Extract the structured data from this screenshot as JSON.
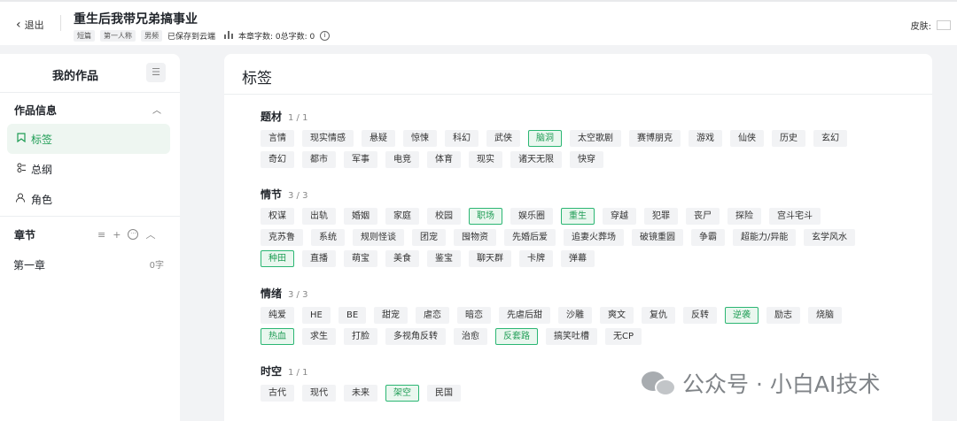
{
  "header": {
    "back_label": "退出",
    "book_title": "重生后我带兄弟搞事业",
    "pills": [
      "短篇",
      "第一人称",
      "男频"
    ],
    "save_status": "已保存到云端",
    "stats": "本章字数: 0总字数: 0",
    "skin_label": "皮肤:"
  },
  "sidebar": {
    "title": "我的作品",
    "section_info": "作品信息",
    "items": [
      {
        "label": "标签",
        "icon": "bookmark-icon",
        "active": true
      },
      {
        "label": "总纲",
        "icon": "outline-icon",
        "active": false
      },
      {
        "label": "角色",
        "icon": "user-icon",
        "active": false
      }
    ],
    "section_chapters": "章节",
    "chapters": [
      {
        "title": "第一章",
        "count": "0字"
      }
    ]
  },
  "main": {
    "title": "标签",
    "groups": [
      {
        "name": "题材",
        "count": "1 / 1",
        "rows": [
          [
            [
              "言情",
              false
            ],
            [
              "现实情感",
              false
            ],
            [
              "悬疑",
              false
            ],
            [
              "惊悚",
              false
            ],
            [
              "科幻",
              false
            ],
            [
              "武侠",
              false
            ],
            [
              "脑洞",
              true
            ],
            [
              "太空歌剧",
              false
            ],
            [
              "赛博朋克",
              false
            ],
            [
              "游戏",
              false
            ],
            [
              "仙侠",
              false
            ],
            [
              "历史",
              false
            ],
            [
              "玄幻",
              false
            ]
          ],
          [
            [
              "奇幻",
              false
            ],
            [
              "都市",
              false
            ],
            [
              "军事",
              false
            ],
            [
              "电竞",
              false
            ],
            [
              "体育",
              false
            ],
            [
              "现实",
              false
            ],
            [
              "诸天无限",
              false
            ],
            [
              "快穿",
              false
            ]
          ]
        ]
      },
      {
        "name": "情节",
        "count": "3 / 3",
        "rows": [
          [
            [
              "权谋",
              false
            ],
            [
              "出轨",
              false
            ],
            [
              "婚姻",
              false
            ],
            [
              "家庭",
              false
            ],
            [
              "校园",
              false
            ],
            [
              "职场",
              true
            ],
            [
              "娱乐圈",
              false
            ],
            [
              "重生",
              true
            ],
            [
              "穿越",
              false
            ],
            [
              "犯罪",
              false
            ],
            [
              "丧尸",
              false
            ],
            [
              "探险",
              false
            ],
            [
              "宫斗宅斗",
              false
            ]
          ],
          [
            [
              "克苏鲁",
              false
            ],
            [
              "系统",
              false
            ],
            [
              "规则怪谈",
              false
            ],
            [
              "团宠",
              false
            ],
            [
              "囤物资",
              false
            ],
            [
              "先婚后爱",
              false
            ],
            [
              "追妻火葬场",
              false
            ],
            [
              "破镜重圆",
              false
            ],
            [
              "争霸",
              false
            ],
            [
              "超能力/异能",
              false
            ],
            [
              "玄学风水",
              false
            ]
          ],
          [
            [
              "种田",
              true
            ],
            [
              "直播",
              false
            ],
            [
              "萌宝",
              false
            ],
            [
              "美食",
              false
            ],
            [
              "鉴宝",
              false
            ],
            [
              "聊天群",
              false
            ],
            [
              "卡牌",
              false
            ],
            [
              "弹幕",
              false
            ]
          ]
        ]
      },
      {
        "name": "情绪",
        "count": "3 / 3",
        "rows": [
          [
            [
              "纯爱",
              false
            ],
            [
              "HE",
              false
            ],
            [
              "BE",
              false
            ],
            [
              "甜宠",
              false
            ],
            [
              "虐恋",
              false
            ],
            [
              "暗恋",
              false
            ],
            [
              "先虐后甜",
              false
            ],
            [
              "沙雕",
              false
            ],
            [
              "爽文",
              false
            ],
            [
              "复仇",
              false
            ],
            [
              "反转",
              false
            ],
            [
              "逆袭",
              true
            ],
            [
              "励志",
              false
            ],
            [
              "烧脑",
              false
            ]
          ],
          [
            [
              "热血",
              true
            ],
            [
              "求生",
              false
            ],
            [
              "打脸",
              false
            ],
            [
              "多视角反转",
              false
            ],
            [
              "治愈",
              false
            ],
            [
              "反套路",
              true
            ],
            [
              "搞笑吐槽",
              false
            ],
            [
              "无CP",
              false
            ]
          ]
        ]
      },
      {
        "name": "时空",
        "count": "1 / 1",
        "rows": [
          [
            [
              "古代",
              false
            ],
            [
              "现代",
              false
            ],
            [
              "未来",
              false
            ],
            [
              "架空",
              true
            ],
            [
              "民国",
              false
            ]
          ]
        ]
      }
    ]
  },
  "watermark": "公众号 · 小白AI技术"
}
